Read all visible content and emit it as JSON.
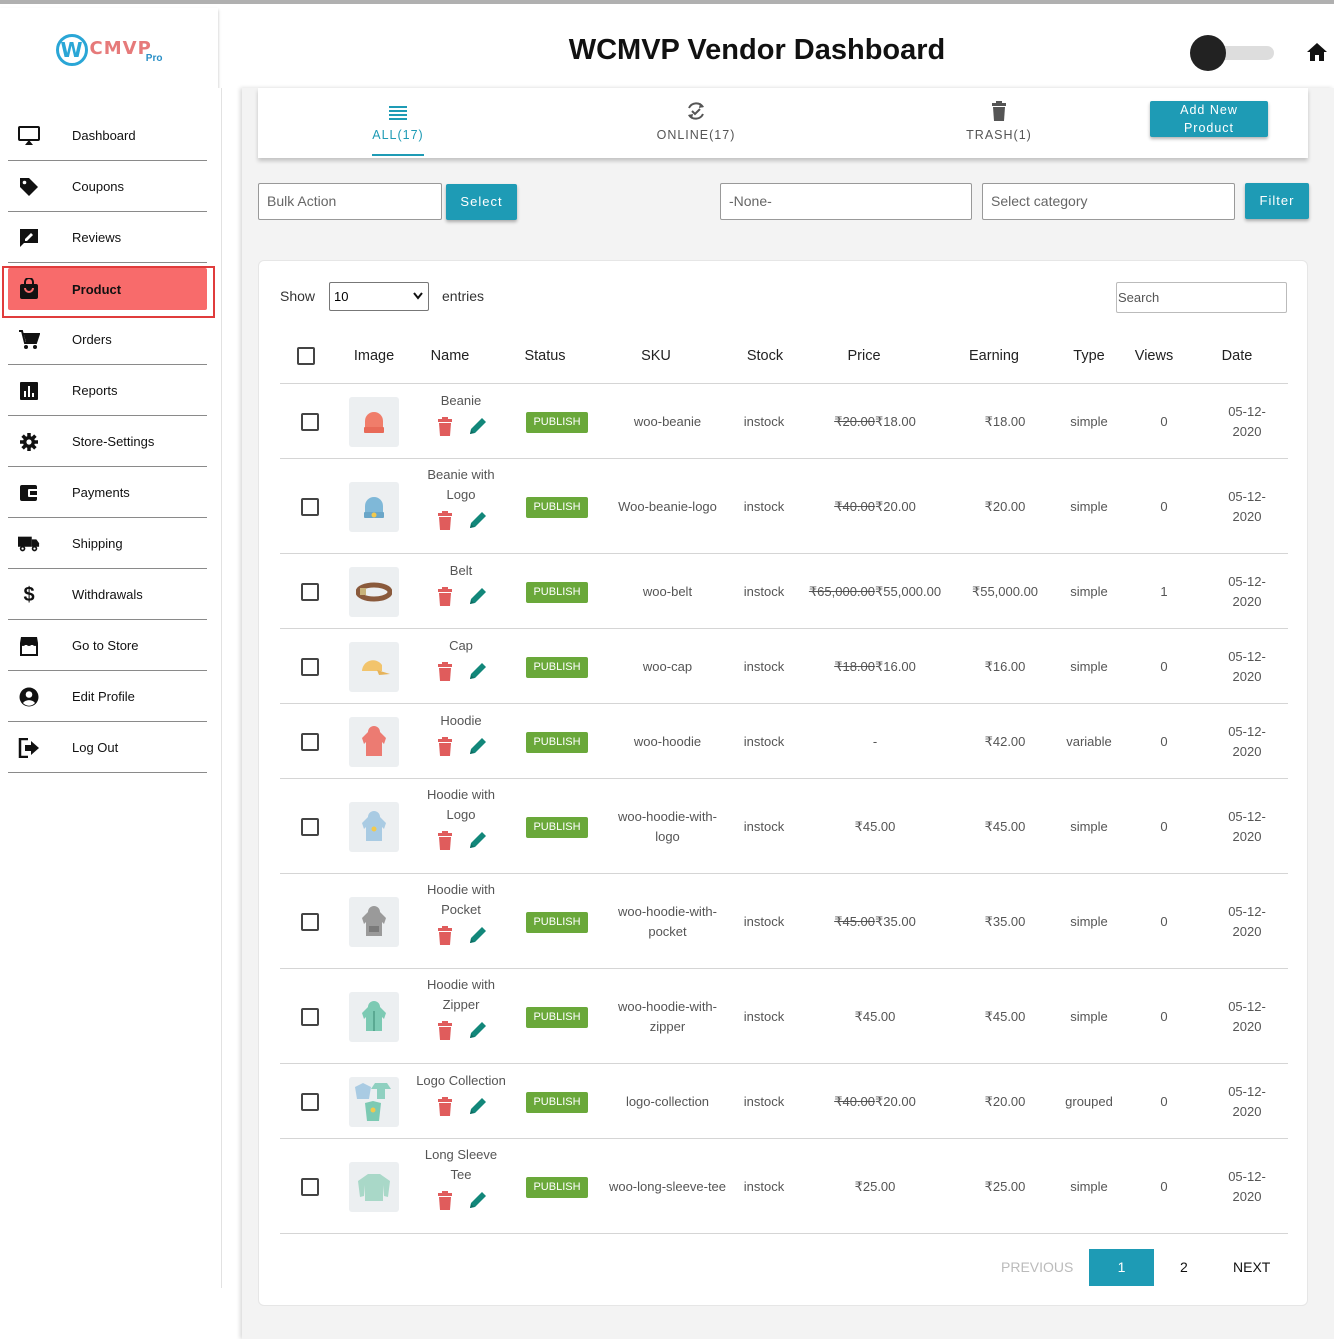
{
  "header": {
    "title": "WCMVP Vendor Dashboard",
    "logo": {
      "mark": "W",
      "text": "CMVP",
      "sub": "Pro"
    },
    "theme_toggle": "off"
  },
  "sidebar": {
    "items": [
      {
        "label": "Dashboard",
        "icon": "monitor-icon"
      },
      {
        "label": "Coupons",
        "icon": "tag-icon"
      },
      {
        "label": "Reviews",
        "icon": "review-icon"
      },
      {
        "label": "Product",
        "icon": "shopping-bag-icon",
        "active": true
      },
      {
        "label": "Orders",
        "icon": "cart-icon"
      },
      {
        "label": "Reports",
        "icon": "bar-chart-icon"
      },
      {
        "label": "Store-Settings",
        "icon": "gear-icon"
      },
      {
        "label": "Payments",
        "icon": "wallet-icon"
      },
      {
        "label": "Shipping",
        "icon": "truck-icon"
      },
      {
        "label": "Withdrawals",
        "icon": "dollar-icon"
      },
      {
        "label": "Go to Store",
        "icon": "store-icon"
      },
      {
        "label": "Edit Profile",
        "icon": "account-icon"
      },
      {
        "label": "Log Out",
        "icon": "logout-icon"
      }
    ]
  },
  "tabs": [
    {
      "label": "ALL(17)",
      "icon": "list-icon",
      "active": true
    },
    {
      "label": "ONLINE(17)",
      "icon": "sync-icon"
    },
    {
      "label": "TRASH(1)",
      "icon": "trash-icon"
    }
  ],
  "add_button": {
    "line1": "Add New",
    "line2": "Product"
  },
  "toolbar": {
    "bulk_action": "Bulk Action",
    "select_label": "Select",
    "none_value": "-None-",
    "category_placeholder": "Select category",
    "filter_label": "Filter"
  },
  "table": {
    "show_label": "Show",
    "entries_value": "10",
    "entries_label": "entries",
    "search_placeholder": "Search",
    "columns": [
      "Image",
      "Name",
      "Status",
      "SKU",
      "Stock",
      "Price",
      "Earning",
      "Type",
      "Views",
      "Date"
    ],
    "rows": [
      {
        "name": [
          "Beanie"
        ],
        "status": "PUBLISH",
        "sku": [
          "woo-beanie"
        ],
        "stock": "instock",
        "price_old": "₹20.00",
        "price": "₹18.00",
        "earning": "₹18.00",
        "type": "simple",
        "views": "0",
        "date": [
          "05-12-",
          "2020"
        ],
        "thumb": "beanie"
      },
      {
        "name": [
          "Beanie with",
          "Logo"
        ],
        "status": "PUBLISH",
        "sku": [
          "Woo-beanie-logo"
        ],
        "stock": "instock",
        "price_old": "₹40.00",
        "price": "₹20.00",
        "earning": "₹20.00",
        "type": "simple",
        "views": "0",
        "date": [
          "05-12-",
          "2020"
        ],
        "thumb": "beanie-logo"
      },
      {
        "name": [
          "Belt"
        ],
        "status": "PUBLISH",
        "sku": [
          "woo-belt"
        ],
        "stock": "instock",
        "price_old": "₹65,000.00",
        "price": "₹55,000.00",
        "earning": "₹55,000.00",
        "type": "simple",
        "views": "1",
        "date": [
          "05-12-",
          "2020"
        ],
        "thumb": "belt"
      },
      {
        "name": [
          "Cap"
        ],
        "status": "PUBLISH",
        "sku": [
          "woo-cap"
        ],
        "stock": "instock",
        "price_old": "₹18.00",
        "price": "₹16.00",
        "earning": "₹16.00",
        "type": "simple",
        "views": "0",
        "date": [
          "05-12-",
          "2020"
        ],
        "thumb": "cap"
      },
      {
        "name": [
          "Hoodie"
        ],
        "status": "PUBLISH",
        "sku": [
          "woo-hoodie"
        ],
        "stock": "instock",
        "price_old": "",
        "price": "-",
        "earning": "₹42.00",
        "type": "variable",
        "views": "0",
        "date": [
          "05-12-",
          "2020"
        ],
        "thumb": "hoodie"
      },
      {
        "name": [
          "Hoodie with",
          "Logo"
        ],
        "status": "PUBLISH",
        "sku": [
          "woo-hoodie-with-",
          "logo"
        ],
        "stock": "instock",
        "price_old": "",
        "price": "₹45.00",
        "earning": "₹45.00",
        "type": "simple",
        "views": "0",
        "date": [
          "05-12-",
          "2020"
        ],
        "thumb": "hoodie-logo"
      },
      {
        "name": [
          "Hoodie with",
          "Pocket"
        ],
        "status": "PUBLISH",
        "sku": [
          "woo-hoodie-with-",
          "pocket"
        ],
        "stock": "instock",
        "price_old": "₹45.00",
        "price": "₹35.00",
        "earning": "₹35.00",
        "type": "simple",
        "views": "0",
        "date": [
          "05-12-",
          "2020"
        ],
        "thumb": "hoodie-pocket"
      },
      {
        "name": [
          "Hoodie with",
          "Zipper"
        ],
        "status": "PUBLISH",
        "sku": [
          "woo-hoodie-with-",
          "zipper"
        ],
        "stock": "instock",
        "price_old": "",
        "price": "₹45.00",
        "earning": "₹45.00",
        "type": "simple",
        "views": "0",
        "date": [
          "05-12-",
          "2020"
        ],
        "thumb": "hoodie-zipper"
      },
      {
        "name": [
          "Logo Collection"
        ],
        "status": "PUBLISH",
        "sku": [
          "logo-collection"
        ],
        "stock": "instock",
        "price_old": "₹40.00",
        "price": "₹20.00",
        "earning": "₹20.00",
        "type": "grouped",
        "views": "0",
        "date": [
          "05-12-",
          "2020"
        ],
        "thumb": "logo-collection"
      },
      {
        "name": [
          "Long Sleeve",
          "Tee"
        ],
        "status": "PUBLISH",
        "sku": [
          "woo-long-sleeve-tee"
        ],
        "stock": "instock",
        "price_old": "",
        "price": "₹25.00",
        "earning": "₹25.00",
        "type": "simple",
        "views": "0",
        "date": [
          "05-12-",
          "2020"
        ],
        "thumb": "long-sleeve-tee"
      }
    ]
  },
  "pagination": {
    "previous": "PREVIOUS",
    "pages": [
      "1",
      "2"
    ],
    "current": "1",
    "next": "NEXT"
  },
  "colors": {
    "accent": "#1e9bb5",
    "active_nav": "#f86b6b",
    "publish": "#6aa83a",
    "delete": "#e05c5c",
    "edit": "#12877a"
  }
}
